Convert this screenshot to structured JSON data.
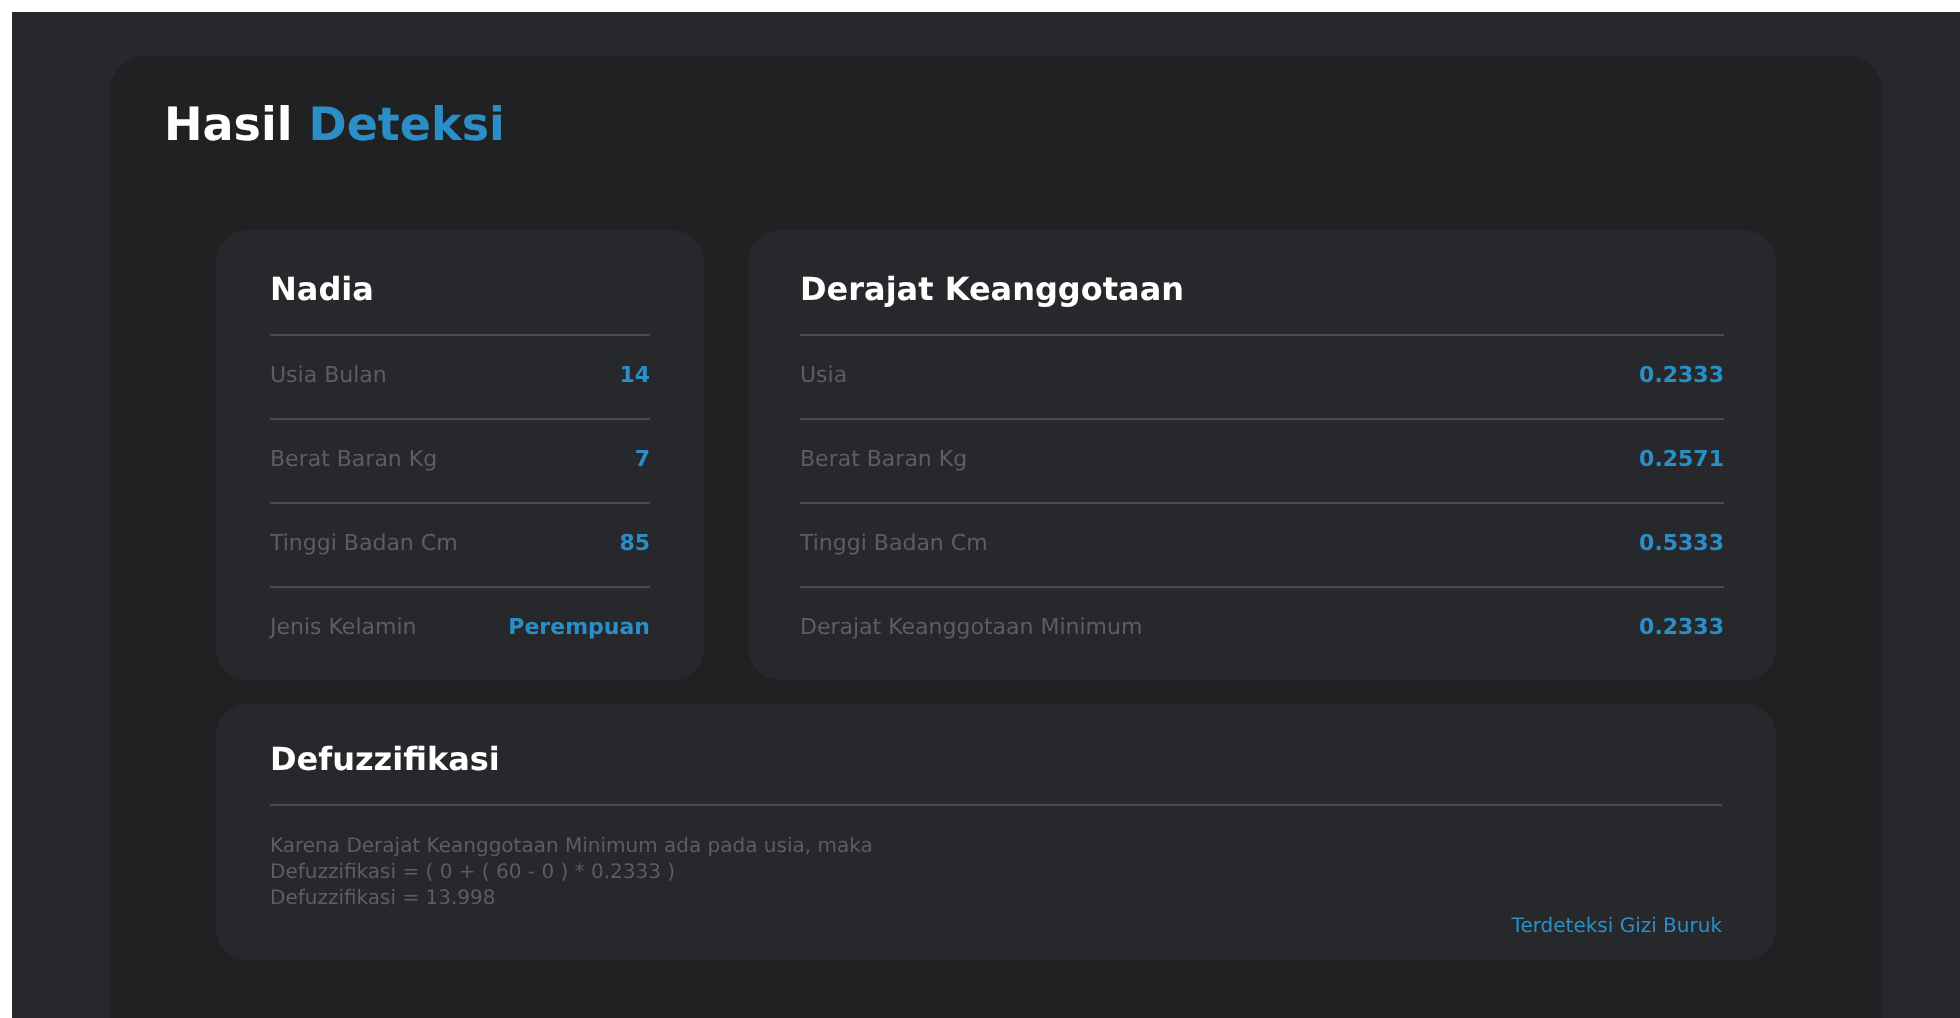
{
  "title": {
    "main": "Hasil",
    "accent": "Deteksi"
  },
  "profile": {
    "name": "Nadia",
    "rows": [
      {
        "label": "Usia Bulan",
        "value": "14"
      },
      {
        "label": "Berat Baran Kg",
        "value": "7"
      },
      {
        "label": "Tinggi Badan Cm",
        "value": "85"
      },
      {
        "label": "Jenis Kelamin",
        "value": "Perempuan"
      }
    ]
  },
  "membership": {
    "title": "Derajat Keanggotaan",
    "rows": [
      {
        "label": "Usia",
        "value": "0.2333"
      },
      {
        "label": "Berat Baran Kg",
        "value": "0.2571"
      },
      {
        "label": "Tinggi Badan Cm",
        "value": "0.5333"
      },
      {
        "label": "Derajat Keanggotaan Minimum",
        "value": "0.2333"
      }
    ]
  },
  "defuzzification": {
    "title": "Defuzzifikasi",
    "lines": [
      "Karena Derajat Keanggotaan Minimum ada pada usia, maka",
      "Defuzzifikasi = ( 0 + ( 60 - 0 ) * 0.2333 )",
      "Defuzzifikasi = 13.998"
    ],
    "result": "Terdeteksi Gizi Buruk"
  }
}
